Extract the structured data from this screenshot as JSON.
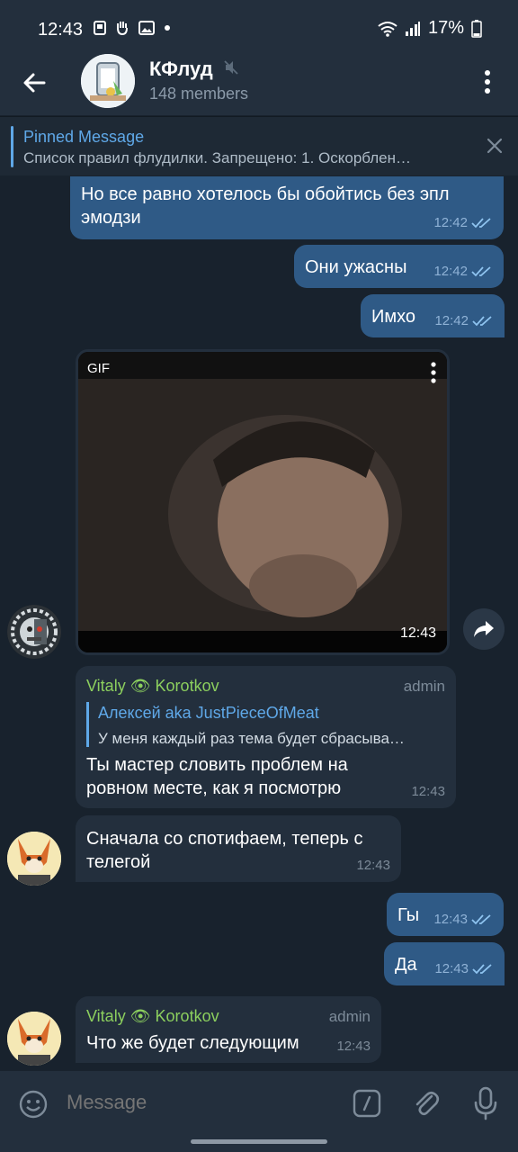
{
  "status": {
    "time": "12:43",
    "battery": "17%"
  },
  "header": {
    "title": "КФлуд",
    "members": "148 members"
  },
  "pinned": {
    "title": "Pinned Message",
    "text": "Список правил флудилки.  Запрещено: 1. Оскорблен…"
  },
  "messages": {
    "m1": {
      "text_line1": "Но все равно хотелось бы обойтись без эпл",
      "text_line2": "эмодзи",
      "time": "12:42"
    },
    "m2": {
      "text": "Они ужасны",
      "time": "12:42"
    },
    "m3": {
      "text": "Имхо",
      "time": "12:42"
    },
    "gif": {
      "label": "GIF",
      "time": "12:43"
    },
    "m4": {
      "sender": "Vitaly 👁 Korotkov",
      "role": "admin",
      "reply_name": "Алексей aka JustPieceOfMeat",
      "reply_text": "У меня каждый раз тема будет сбрасыва…",
      "text_line1": "Ты мастер словить проблем на",
      "text_line2": "ровном месте, как я посмотрю",
      "time": "12:43"
    },
    "m5": {
      "text_line1": "Сначала со спотифаем, теперь с",
      "text_line2": "телегой",
      "time": "12:43"
    },
    "m6": {
      "text": "Гы",
      "time": "12:43"
    },
    "m7": {
      "text": "Да",
      "time": "12:43"
    },
    "m8": {
      "sender": "Vitaly 👁 Korotkov",
      "role": "admin",
      "text": "Что же будет следующим",
      "time": "12:43"
    }
  },
  "input": {
    "placeholder": "Message"
  },
  "colors": {
    "outgoing": "#2f5a86",
    "incoming": "#232f3d",
    "accent": "#5fa8e8",
    "sender": "#8ccf5e"
  }
}
